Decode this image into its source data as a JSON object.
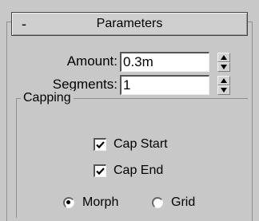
{
  "rollout": {
    "toggle": "-",
    "title": "Parameters"
  },
  "fields": {
    "amount": {
      "label": "Amount:",
      "value": "0.3m"
    },
    "segments": {
      "label": "Segments:",
      "value": "1"
    }
  },
  "capping": {
    "title": "Capping",
    "cap_start": {
      "label": "Cap Start",
      "checked": true
    },
    "cap_end": {
      "label": "Cap End",
      "checked": true
    },
    "morph": {
      "label": "Morph",
      "selected": true
    },
    "grid": {
      "label": "Grid",
      "selected": false
    }
  },
  "icons": {
    "spinner_up": "spinner-up-arrow-icon",
    "spinner_down": "spinner-down-arrow-icon",
    "checkmark": "checkmark-icon"
  }
}
